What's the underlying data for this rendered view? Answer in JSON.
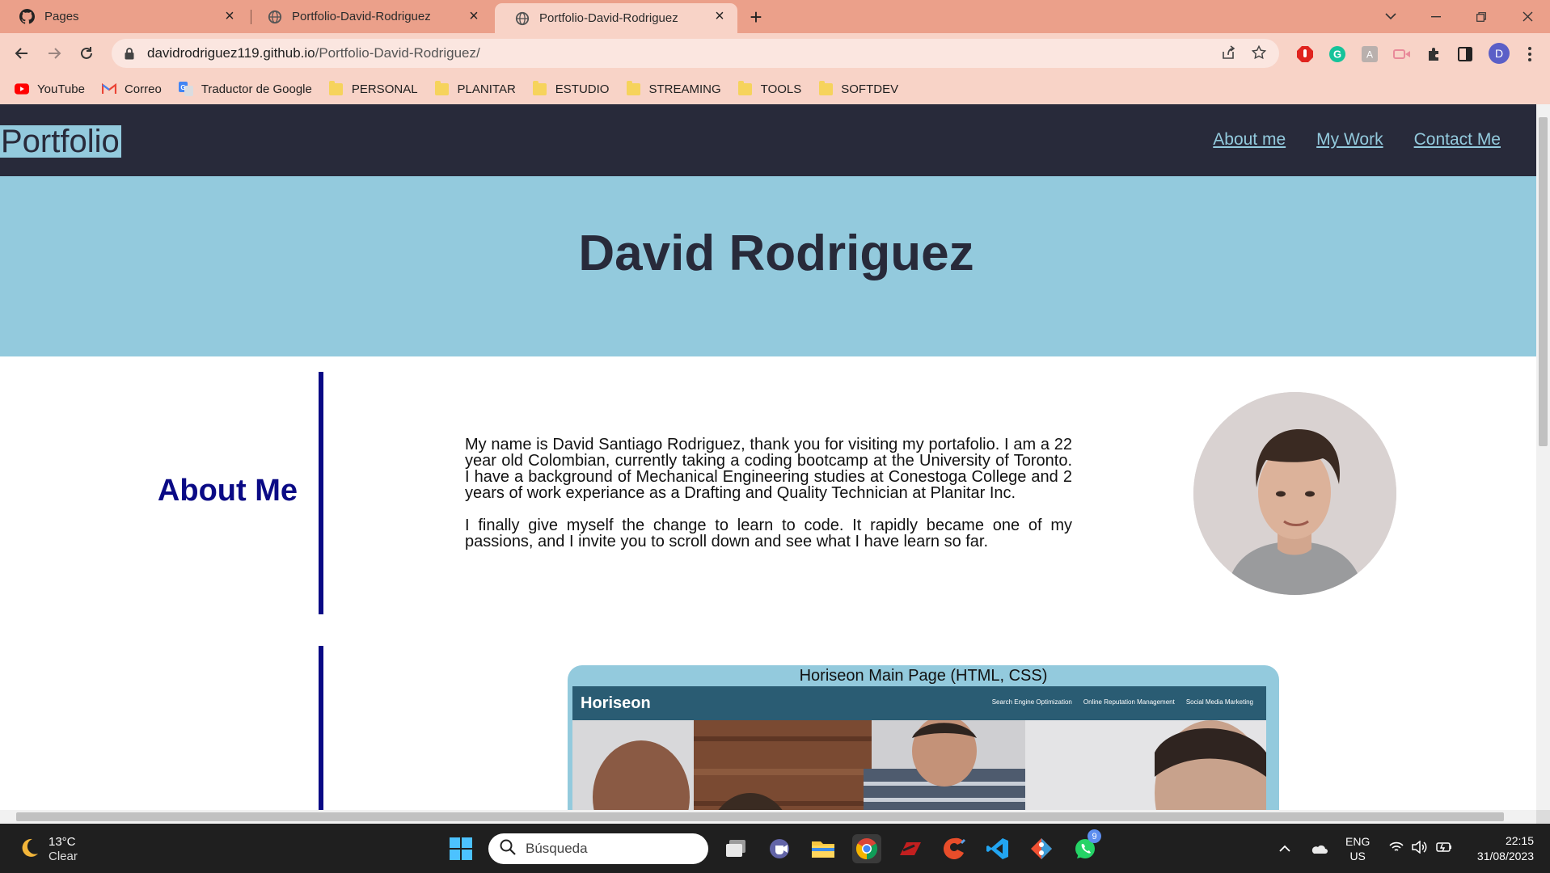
{
  "tabs": [
    {
      "title": "Pages",
      "icon": "github-icon",
      "active": false
    },
    {
      "title": "Portfolio-David-Rodriguez",
      "icon": "globe-icon",
      "active": false
    },
    {
      "title": "Portfolio-David-Rodriguez",
      "icon": "globe-icon",
      "active": true
    }
  ],
  "address": {
    "domain": "davidrodriguez119.github.io",
    "path": "/Portfolio-David-Rodriguez/"
  },
  "bookmarks": [
    {
      "label": "YouTube",
      "icon": "youtube-icon"
    },
    {
      "label": "Correo",
      "icon": "gmail-icon"
    },
    {
      "label": "Traductor de Google",
      "icon": "google-translate-icon"
    },
    {
      "label": "PERSONAL",
      "icon": "folder-icon"
    },
    {
      "label": "PLANITAR",
      "icon": "folder-icon"
    },
    {
      "label": "ESTUDIO",
      "icon": "folder-icon"
    },
    {
      "label": "STREAMING",
      "icon": "folder-icon"
    },
    {
      "label": "TOOLS",
      "icon": "folder-icon"
    },
    {
      "label": "SOFTDEV",
      "icon": "folder-icon"
    }
  ],
  "profile": {
    "initial": "D"
  },
  "site": {
    "brand": "Portfolio",
    "nav": [
      "About me",
      "My Work",
      "Contact Me"
    ],
    "hero_title": "David Rodriguez",
    "about": {
      "heading": "About Me",
      "paragraphs": [
        "My name is David Santiago Rodriguez, thank you for visiting my portafolio. I am a 22 year old Colombian, currently taking a coding bootcamp at the University of Toronto. I have a background of Mechanical Engineering studies at Conestoga College and 2 years of work experiance as a Drafting and Quality Technician at Planitar Inc.",
        "I finally give myself the change to learn to code. It rapidly became one of my passions, and I invite you to scroll down and see what I have learn so far."
      ]
    },
    "work": {
      "title": "Horiseon Main Page (HTML, CSS)",
      "preview": {
        "logo": "Horiseon",
        "links": [
          "Search Engine Optimization",
          "Online Reputation Management",
          "Social Media Marketing"
        ]
      }
    }
  },
  "taskbar": {
    "weather": {
      "temp": "13°C",
      "condition": "Clear"
    },
    "search_placeholder": "Búsqueda",
    "whatsapp_badge": "9",
    "language": {
      "lang": "ENG",
      "region": "US"
    },
    "time": "22:15",
    "date": "31/08/2023"
  },
  "colors": {
    "tab_bar": "#eba08a",
    "toolbar": "#f8d3c7",
    "site_dark": "#282a3a",
    "site_light": "#93cadd",
    "about_accent": "#0a0a85"
  }
}
